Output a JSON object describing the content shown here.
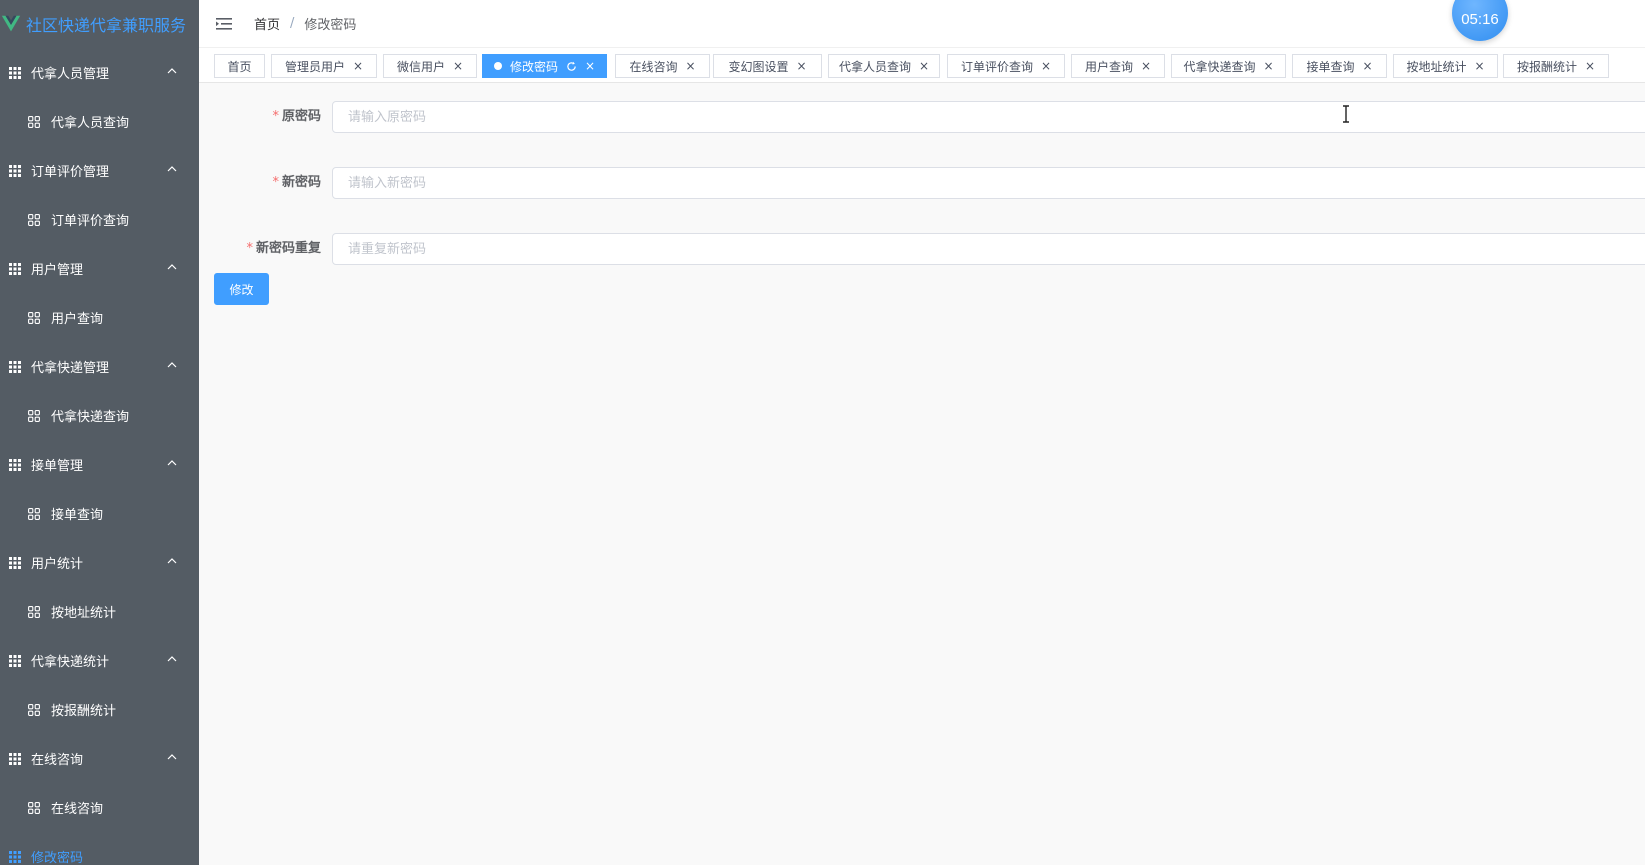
{
  "brand": {
    "title": "社区快递代拿兼职服务",
    "color": "#409eff"
  },
  "sidebar": {
    "groups": [
      {
        "label": "代拿人员管理",
        "icon": "grid-icon",
        "sub": "代拿人员查询"
      },
      {
        "label": "订单评价管理",
        "icon": "grid-icon",
        "sub": "订单评价查询"
      },
      {
        "label": "用户管理",
        "icon": "grid-icon",
        "sub": "用户查询"
      },
      {
        "label": "代拿快递管理",
        "icon": "grid-icon",
        "sub": "代拿快递查询"
      },
      {
        "label": "接单管理",
        "icon": "grid-icon",
        "sub": "接单查询"
      },
      {
        "label": "用户统计",
        "icon": "grid-icon",
        "sub": "按地址统计"
      },
      {
        "label": "代拿快递统计",
        "icon": "grid-icon",
        "sub": "按报酬统计"
      },
      {
        "label": "在线咨询",
        "icon": "grid-icon",
        "sub": "在线咨询"
      }
    ],
    "active_item": "修改密码",
    "background": "#545c64",
    "active_color": "#409eff"
  },
  "header": {
    "breadcrumb": [
      "首页",
      "修改密码"
    ],
    "separator": "/",
    "timer": "05:16"
  },
  "tags": [
    {
      "label": "首页",
      "closable": false,
      "active": false
    },
    {
      "label": "管理员用户",
      "closable": true,
      "active": false
    },
    {
      "label": "微信用户",
      "closable": true,
      "active": false
    },
    {
      "label": "修改密码",
      "closable": true,
      "active": true
    },
    {
      "label": "在线咨询",
      "closable": true,
      "active": false
    },
    {
      "label": "变幻图设置",
      "closable": true,
      "active": false
    },
    {
      "label": "代拿人员查询",
      "closable": true,
      "active": false
    },
    {
      "label": "订单评价查询",
      "closable": true,
      "active": false
    },
    {
      "label": "用户查询",
      "closable": true,
      "active": false
    },
    {
      "label": "代拿快递查询",
      "closable": true,
      "active": false
    },
    {
      "label": "接单查询",
      "closable": true,
      "active": false
    },
    {
      "label": "按地址统计",
      "closable": true,
      "active": false
    },
    {
      "label": "按报酬统计",
      "closable": true,
      "active": false
    }
  ],
  "form": {
    "required_mark": "*",
    "old_password": {
      "label": "原密码",
      "placeholder": "请输入原密码",
      "value": ""
    },
    "new_password": {
      "label": "新密码",
      "placeholder": "请输入新密码",
      "value": ""
    },
    "repeat_password": {
      "label": "新密码重复",
      "placeholder": "请重复新密码",
      "value": ""
    },
    "submit_label": "修改"
  }
}
